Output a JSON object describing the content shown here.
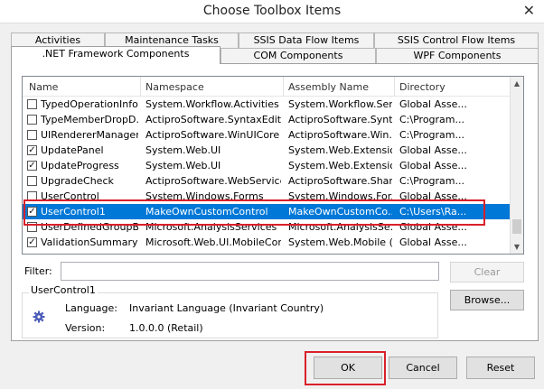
{
  "window": {
    "title": "Choose Toolbox Items",
    "close_glyph": "✕"
  },
  "tabs_back": [
    "Activities",
    "Maintenance Tasks",
    "SSIS Data Flow Items",
    "SSIS Control Flow Items"
  ],
  "tabs_front": [
    ".NET Framework Components",
    "COM Components",
    "WPF Components"
  ],
  "columns": [
    "Name",
    "Namespace",
    "Assembly Name",
    "Directory"
  ],
  "rows": [
    {
      "checked": false,
      "name": "TypedOperationInfo",
      "namespace": "System.Workflow.Activities",
      "assembly": "System.Workflow.Servi...",
      "directory": "Global Asse..."
    },
    {
      "checked": false,
      "name": "TypeMemberDropD...",
      "namespace": "ActiproSoftware.SyntaxEditor...",
      "assembly": "ActiproSoftware.Synt...",
      "directory": "C:\\Program..."
    },
    {
      "checked": false,
      "name": "UIRendererManager",
      "namespace": "ActiproSoftware.WinUICore",
      "assembly": "ActiproSoftware.Win...",
      "directory": "C:\\Program..."
    },
    {
      "checked": true,
      "name": "UpdatePanel",
      "namespace": "System.Web.UI",
      "assembly": "System.Web.Extensio...",
      "directory": "Global Asse..."
    },
    {
      "checked": true,
      "name": "UpdateProgress",
      "namespace": "System.Web.UI",
      "assembly": "System.Web.Extensio...",
      "directory": "Global Asse..."
    },
    {
      "checked": false,
      "name": "UpgradeCheck",
      "namespace": "ActiproSoftware.WebServices",
      "assembly": "ActiproSoftware.Shar...",
      "directory": "C:\\Program..."
    },
    {
      "checked": false,
      "name": "UserControl",
      "namespace": "System.Windows.Forms",
      "assembly": "System.Windows.For...",
      "directory": "Global Asse..."
    },
    {
      "checked": true,
      "name": "UserControl1",
      "namespace": "MakeOwnCustomControl",
      "assembly": "MakeOwnCustomCo...",
      "directory": "C:\\Users\\Ra..."
    },
    {
      "checked": false,
      "name": "UserDefinedGroupBi...",
      "namespace": "Microsoft.AnalysisServices",
      "assembly": "Microsoft.AnalysisSe...",
      "directory": "Global Asse..."
    },
    {
      "checked": true,
      "name": "ValidationSummary",
      "namespace": "Microsoft.Web.UI.MobileContr...",
      "assembly": "System.Web.Mobile (...",
      "directory": "Global Asse..."
    }
  ],
  "filter": {
    "label": "Filter:",
    "value": "",
    "clear_label": "Clear"
  },
  "details": {
    "title": "UserControl1",
    "language_label": "Language:",
    "language_value": "Invariant Language (Invariant Country)",
    "version_label": "Version:",
    "version_value": "1.0.0.0 (Retail)",
    "browse_label": "Browse..."
  },
  "buttons": {
    "ok": "OK",
    "cancel": "Cancel",
    "reset": "Reset"
  },
  "scrollbar": {
    "up_glyph": "▲",
    "down_glyph": "▼"
  },
  "colors": {
    "selection": "#0078d7",
    "highlight_box": "#d9202b"
  },
  "icons": {
    "component": "gear-icon",
    "close": "close-icon"
  }
}
